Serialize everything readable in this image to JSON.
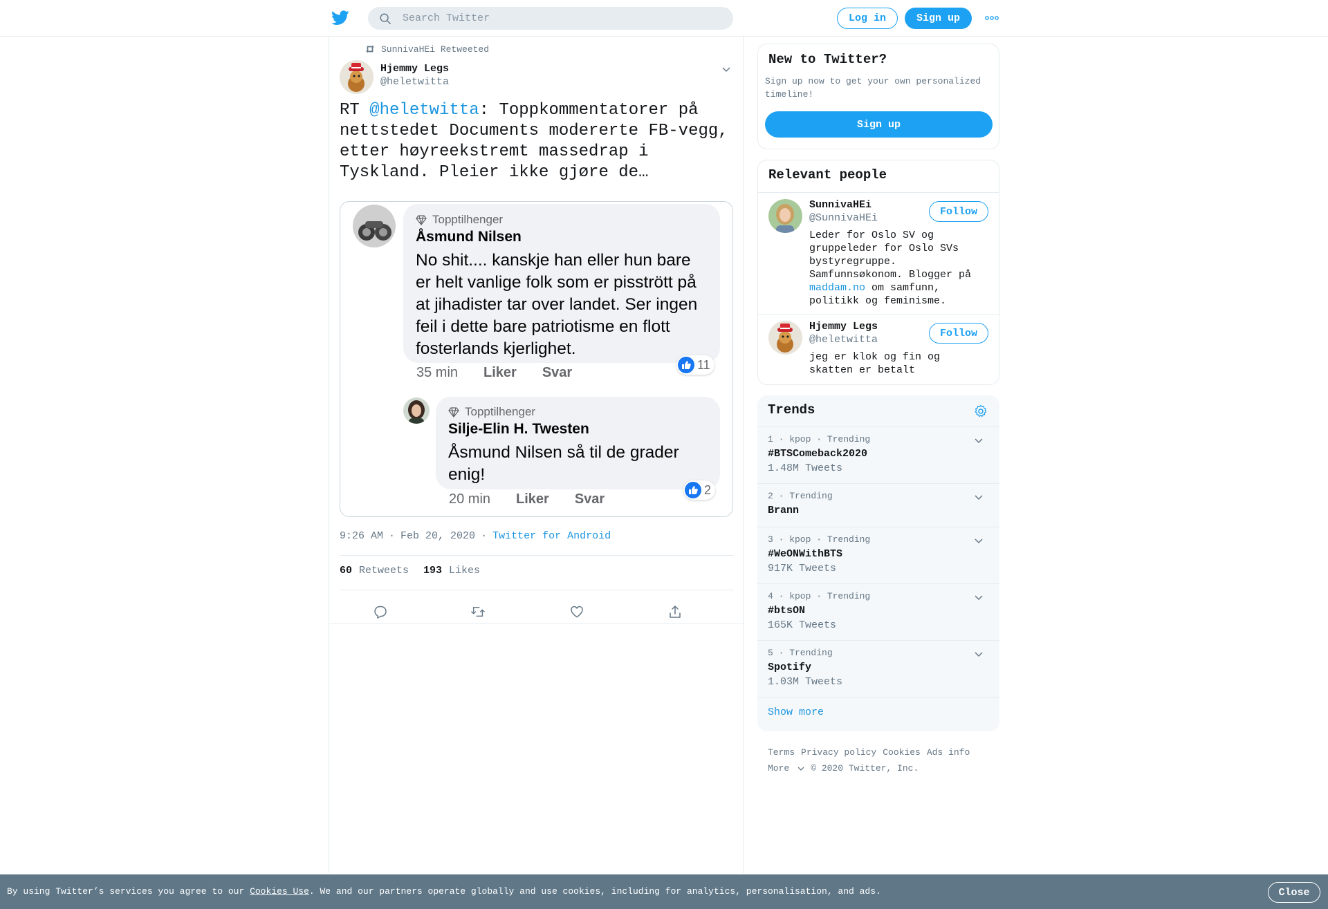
{
  "header": {
    "search_placeholder": "Search Twitter",
    "login_label": "Log in",
    "signup_label": "Sign up"
  },
  "tweet": {
    "retweeted_by": "SunnivaHEi Retweeted",
    "author_name": "Hjemmy Legs",
    "author_handle": "@heletwitta",
    "text_prefix": "RT ",
    "text_mention": "@heletwitta",
    "text_body": ": Toppkommentatorer på nettstedet Documents modererte FB-vegg, etter høyreekstremt massedrap i Tyskland. Pleier ikke gjøre de…",
    "time": "9:26 AM",
    "date": "Feb 20, 2020",
    "source": "Twitter for Android",
    "retweets_count": "60",
    "retweets_label": "Retweets",
    "likes_count": "193",
    "likes_label": "Likes",
    "media": {
      "comment1": {
        "badge": "Topptilhenger",
        "name": "Åsmund Nilsen",
        "text": "No shit.... kanskje han eller hun bare er helt vanlige folk som er pisstrött på at jihadister tar over landet. Ser ingen feil i dette bare patriotisme en flott fosterlands kjerlighet.",
        "time": "35 min",
        "like": "Liker",
        "reply": "Svar",
        "reactions": "11"
      },
      "comment2": {
        "badge": "Topptilhenger",
        "name": "Silje-Elin H. Twesten",
        "text": "Åsmund Nilsen så til de grader enig!",
        "time": "20 min",
        "like": "Liker",
        "reply": "Svar",
        "reactions": "2"
      }
    }
  },
  "sidebar": {
    "new": {
      "title": "New to Twitter?",
      "desc": "Sign up now to get your own personalized timeline!",
      "signup_label": "Sign up"
    },
    "people": {
      "title": "Relevant people",
      "list": [
        {
          "name": "SunnivaHEi",
          "handle": "@SunnivaHEi",
          "bio_before": "Leder for Oslo SV og gruppeleder for Oslo SVs bystyregruppe. Samfunnsøkonom. Blogger på ",
          "bio_link": "maddam.no",
          "bio_after": " om samfunn, politikk og feminisme.",
          "follow_label": "Follow"
        },
        {
          "name": "Hjemmy Legs",
          "handle": "@heletwitta",
          "bio": "jeg er klok og fin og skatten er betalt",
          "follow_label": "Follow"
        }
      ]
    },
    "trends": {
      "title": "Trends",
      "items": [
        {
          "meta": "1 · kpop · Trending",
          "name": "#BTSComeback2020",
          "count": "1.48M Tweets"
        },
        {
          "meta": "2 · Trending",
          "name": "Brann",
          "count": ""
        },
        {
          "meta": "3 · kpop · Trending",
          "name": "#WeONWithBTS",
          "count": "917K Tweets"
        },
        {
          "meta": "4 · kpop · Trending",
          "name": "#btsON",
          "count": "165K Tweets"
        },
        {
          "meta": "5 · Trending",
          "name": "Spotify",
          "count": "1.03M Tweets"
        }
      ],
      "show_more": "Show more"
    },
    "footer": {
      "terms": "Terms",
      "privacy": "Privacy policy",
      "cookies": "Cookies",
      "ads": "Ads info",
      "more": "More",
      "copyright": "© 2020 Twitter, Inc."
    }
  },
  "cookie_bar": {
    "text_before": "By using Twitter’s services you agree to our ",
    "link": "Cookies Use",
    "text_after": ". We and our partners operate globally and use cookies, including for analytics, personalisation, and ads.",
    "close_label": "Close"
  },
  "colors": {
    "accent": "#1da1f2",
    "link": "#1b95e0",
    "muted": "#657786",
    "cookie_bg": "#5f7787"
  }
}
